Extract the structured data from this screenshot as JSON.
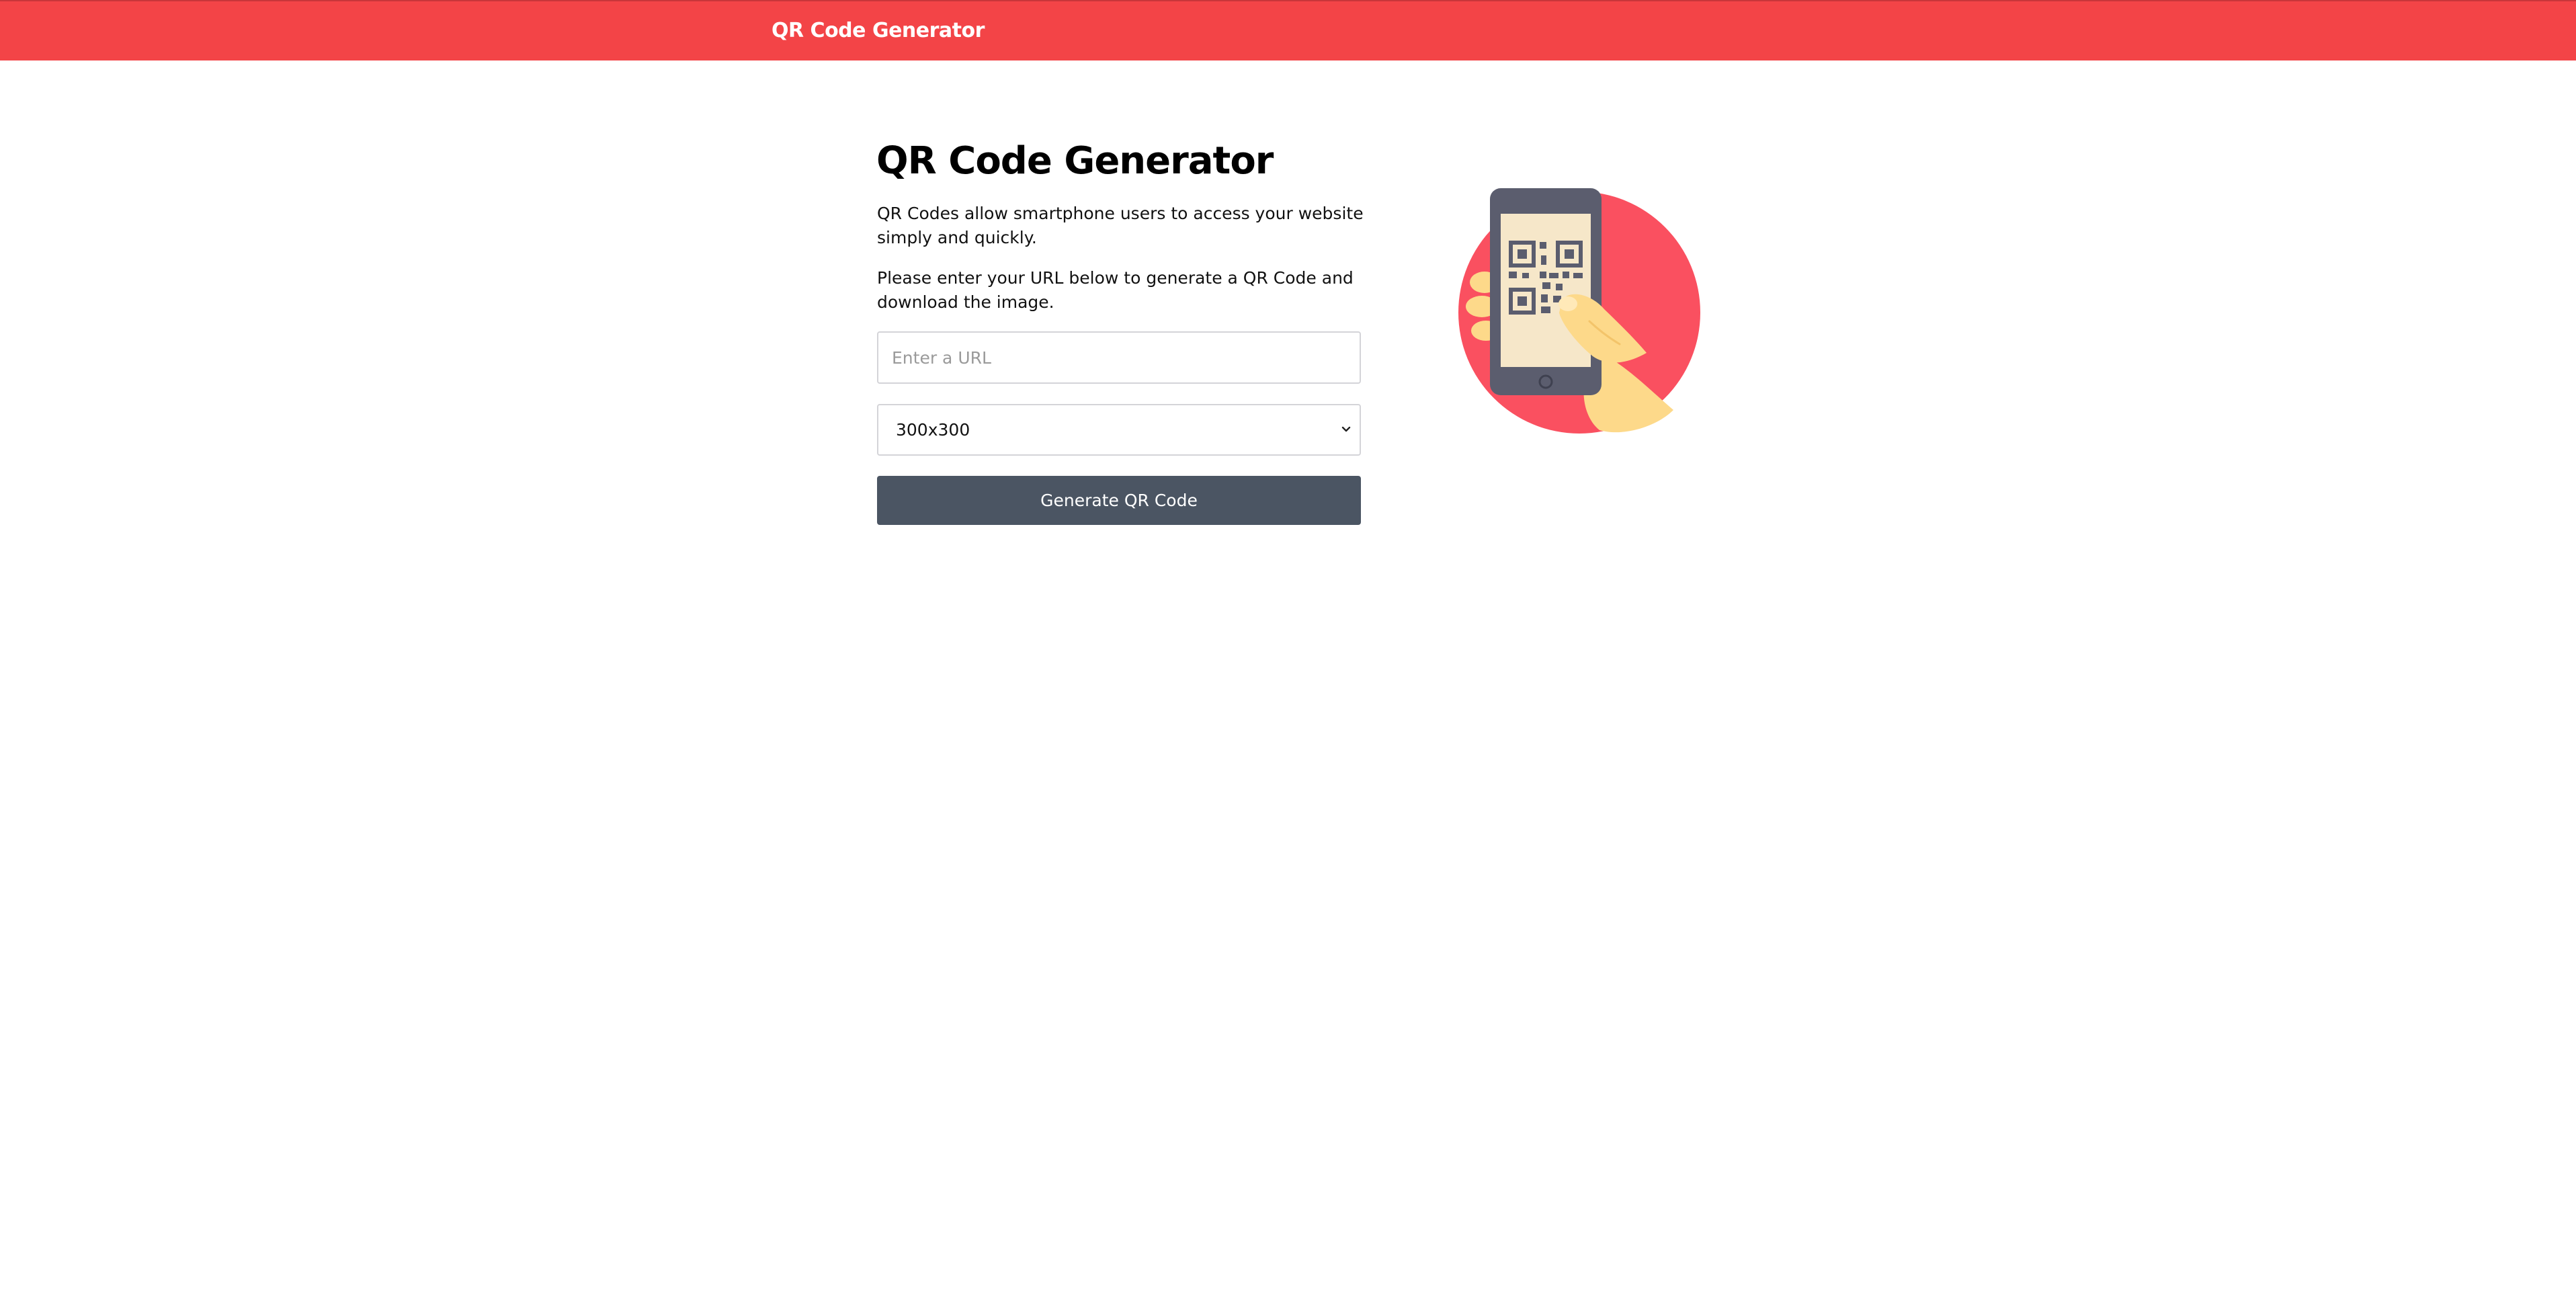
{
  "navbar": {
    "brand": "QR Code Generator",
    "background_color": "#f34447"
  },
  "main": {
    "title": "QR Code Generator",
    "paragraphs": [
      "QR Codes allow smartphone users to access your website simply and quickly.",
      "Please enter your URL below to generate a QR Code and download the image."
    ],
    "url_input": {
      "value": "",
      "placeholder": "Enter a URL"
    },
    "size_select": {
      "selected": "300x300",
      "icon": "chevron-down-icon"
    },
    "generate_button": {
      "label": "Generate QR Code",
      "color": "#4b5563"
    }
  },
  "illustration": {
    "icon": "hand-holding-phone-qr-icon",
    "circle_color": "#fa5060",
    "phone_color": "#5b5d6e",
    "screen_color": "#f6e7c9",
    "hand_color": "#fdd98a"
  }
}
